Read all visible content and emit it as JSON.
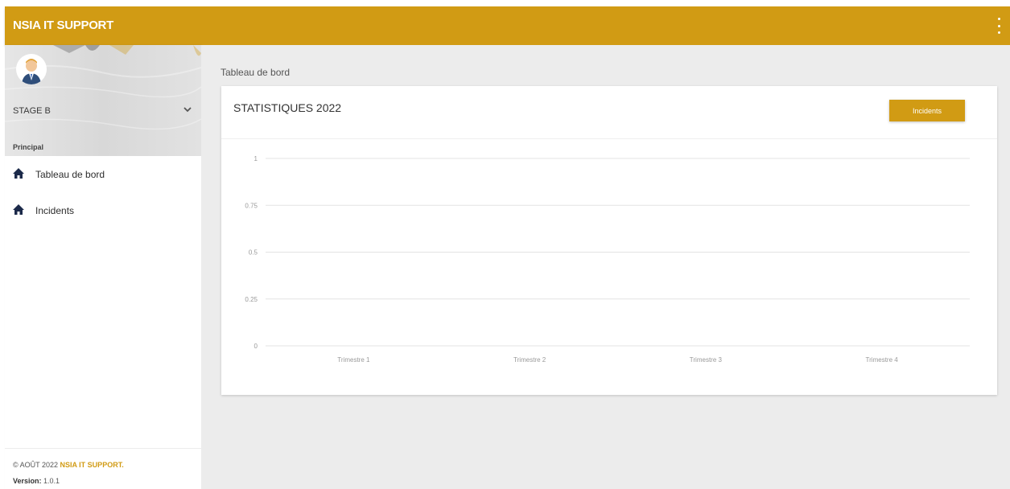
{
  "app": {
    "title": "NSIA IT SUPPORT"
  },
  "sidebar": {
    "user_name": "STAGE B",
    "section_label": "Principal",
    "items": [
      {
        "label": "Tableau de bord",
        "icon": "home-icon"
      },
      {
        "label": "Incidents",
        "icon": "home-icon"
      }
    ],
    "footer": {
      "copyright_prefix": "© AOÛT 2022",
      "brand": "NSIA IT SUPPORT.",
      "version_label": "Version:",
      "version_value": "1.0.1"
    }
  },
  "main": {
    "page_title": "Tableau de bord",
    "card": {
      "title": "STATISTIQUES 2022",
      "button_label": "Incidents"
    }
  },
  "colors": {
    "accent": "#d19b14",
    "background": "#ececec"
  },
  "chart_data": {
    "type": "bar",
    "categories": [
      "Trimestre 1",
      "Trimestre 2",
      "Trimestre 3",
      "Trimestre 4"
    ],
    "series": [
      {
        "values": [
          0,
          0,
          0,
          0
        ]
      }
    ],
    "yticks": [
      "0",
      "0.25",
      "0.5",
      "0.75",
      "1"
    ],
    "ylim": [
      0,
      1
    ],
    "grid": true
  }
}
